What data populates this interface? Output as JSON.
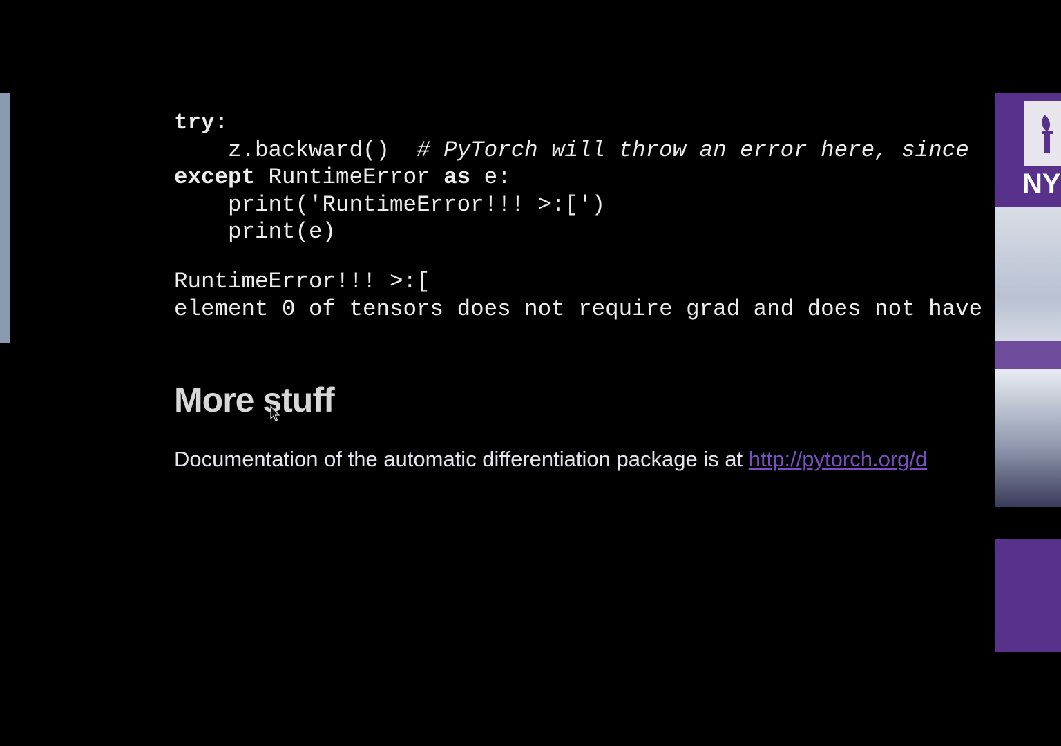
{
  "code": {
    "line1": {
      "kw": "try:"
    },
    "line2": {
      "code": "    z.backward()  ",
      "comment": "# PyTorch will throw an error here, since"
    },
    "line3": {
      "kw1": "except",
      "mid": " RuntimeError ",
      "kw2": "as",
      "rest": " e:"
    },
    "line4": {
      "text": "    print('RuntimeError!!! >:[')"
    },
    "line5": {
      "text": "    print(e)"
    }
  },
  "output": {
    "line1": "RuntimeError!!! >:[",
    "line2": "element 0 of tensors does not require grad and does not have"
  },
  "section": {
    "heading": "More stuff",
    "paragraph": "Documentation of the automatic differentiation package is at ",
    "link_text": "http://pytorch.org/d"
  },
  "webcam": {
    "logo_text": "NY"
  },
  "icons": {
    "cursor": "mouse-pointer-icon"
  }
}
